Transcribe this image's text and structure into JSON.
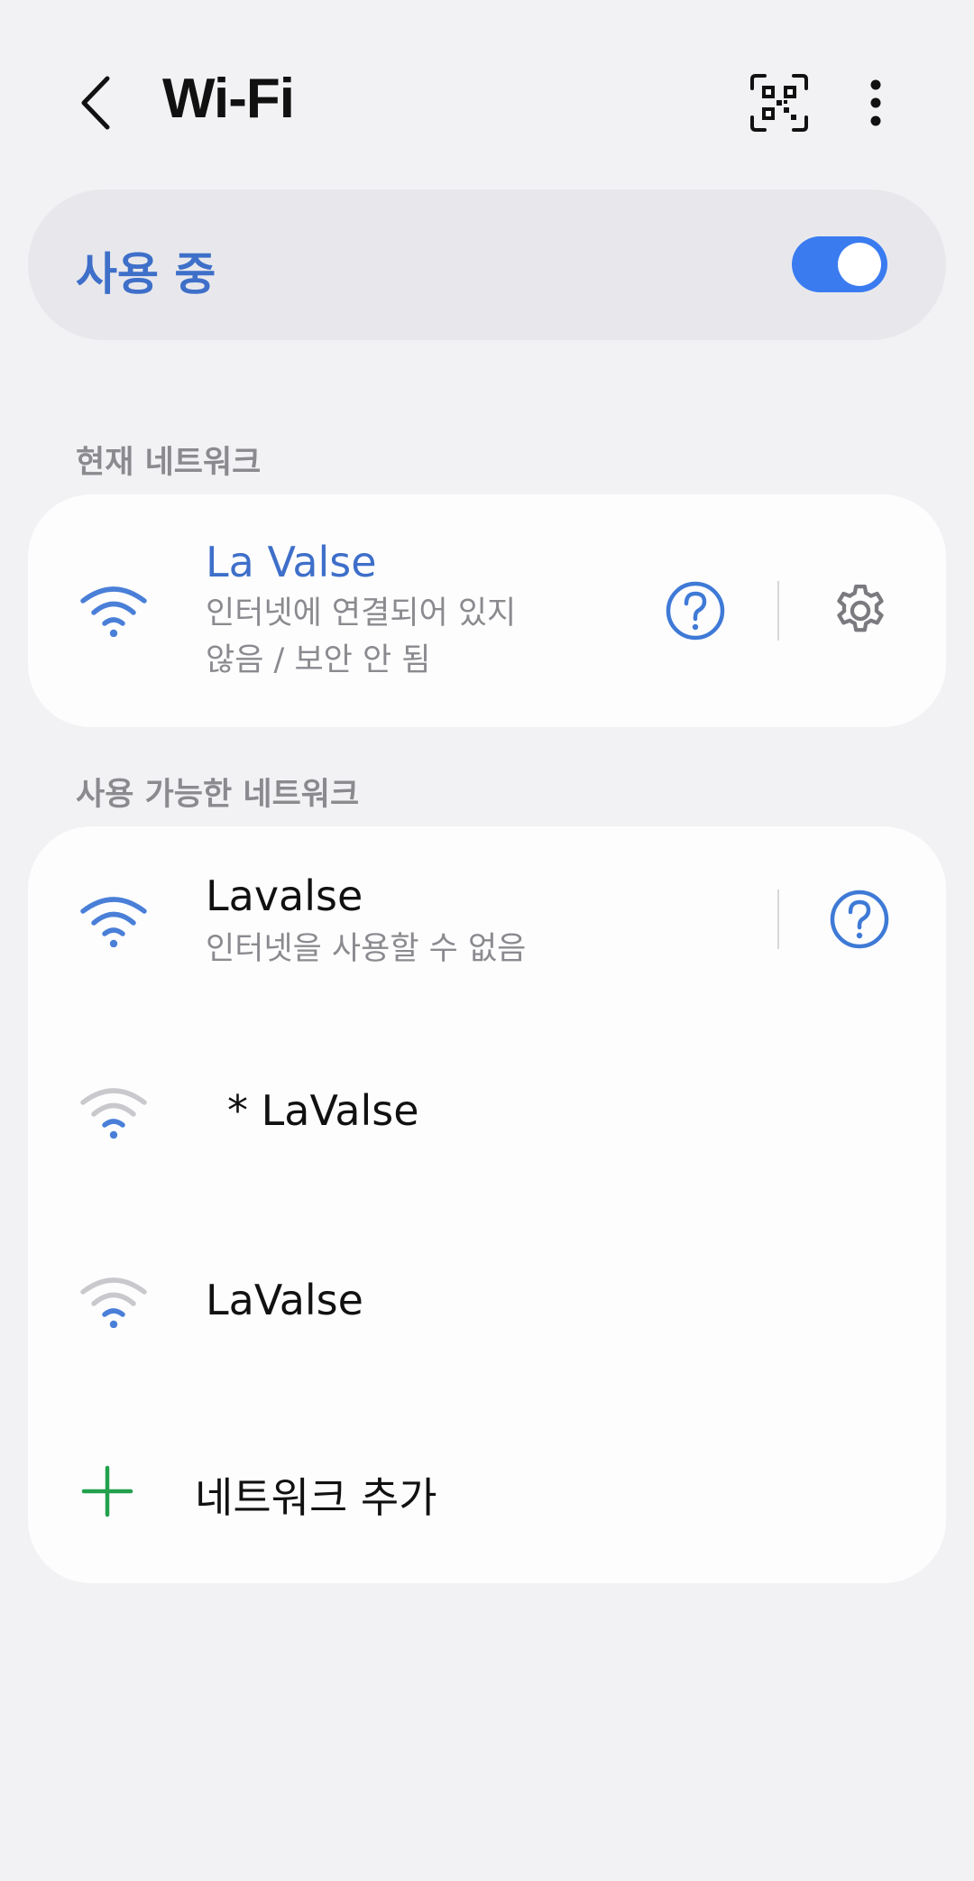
{
  "header": {
    "title": "Wi-Fi",
    "back_icon": "chevron-left-icon",
    "qr_icon": "qr-code-scan-icon",
    "more_icon": "more-vertical-icon"
  },
  "master_switch": {
    "label": "사용 중",
    "state": "on",
    "accent_color": "#3a7bf0"
  },
  "current_network": {
    "section_label": "현재 네트워크",
    "name": "La Valse",
    "status_line1": "인터넷에 연결되어 있지",
    "status_line2": "않음 / 보안 안 됨",
    "icons": [
      "wifi-icon",
      "help-icon",
      "gear-icon"
    ]
  },
  "available_networks": {
    "section_label": "사용 가능한 네트워크",
    "items": [
      {
        "name": "Lavalse",
        "status": "인터넷을 사용할 수 없음",
        "signal": "full",
        "icon": "wifi-icon"
      },
      {
        "name": "* LaValse",
        "signal": "weak",
        "icon": "wifi-weak-icon"
      },
      {
        "name": "LaValse",
        "signal": "weak",
        "icon": "wifi-weak-icon"
      }
    ],
    "add_label": "네트워크 추가",
    "add_icon": "plus-icon"
  },
  "colors": {
    "accent": "#3e6fc9",
    "add_green": "#22a04c"
  }
}
